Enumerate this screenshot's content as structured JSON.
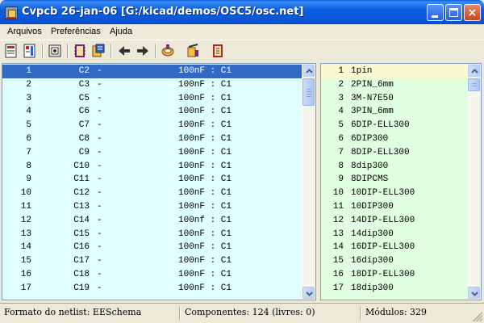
{
  "window": {
    "title": "Cvpcb 26-jan-06 [G:/kicad/demos/OSC5/osc.net]",
    "minimize": "_",
    "maximize": "□",
    "close": "×"
  },
  "menu": {
    "items": [
      "Arquivos",
      "Preferências",
      "Ajuda"
    ]
  },
  "toolbar": {
    "icons": [
      "open-netlist-icon",
      "save-netlist-icon",
      "config-icon",
      "footprint-display-icon",
      "documentation-icon",
      "previous-arrow-icon",
      "next-arrow-icon",
      "auto-associate-icon",
      "delete-association-icon",
      "print-list-icon"
    ]
  },
  "components": {
    "rows": [
      {
        "num": "1",
        "ref": "C2",
        "dash": "-",
        "value": "100nF : C1"
      },
      {
        "num": "2",
        "ref": "C3",
        "dash": "-",
        "value": "100nF : C1"
      },
      {
        "num": "3",
        "ref": "C5",
        "dash": "-",
        "value": "100nF : C1"
      },
      {
        "num": "4",
        "ref": "C6",
        "dash": "-",
        "value": "100nF : C1"
      },
      {
        "num": "5",
        "ref": "C7",
        "dash": "-",
        "value": "100nF : C1"
      },
      {
        "num": "6",
        "ref": "C8",
        "dash": "-",
        "value": "100nF : C1"
      },
      {
        "num": "7",
        "ref": "C9",
        "dash": "-",
        "value": "100nF : C1"
      },
      {
        "num": "8",
        "ref": "C10",
        "dash": "-",
        "value": "100nF : C1"
      },
      {
        "num": "9",
        "ref": "C11",
        "dash": "-",
        "value": "100nF : C1"
      },
      {
        "num": "10",
        "ref": "C12",
        "dash": "-",
        "value": "100nF : C1"
      },
      {
        "num": "11",
        "ref": "C13",
        "dash": "-",
        "value": "100nF : C1"
      },
      {
        "num": "12",
        "ref": "C14",
        "dash": "-",
        "value": "100nf : C1"
      },
      {
        "num": "13",
        "ref": "C15",
        "dash": "-",
        "value": "100nF : C1"
      },
      {
        "num": "14",
        "ref": "C16",
        "dash": "-",
        "value": "100nF : C1"
      },
      {
        "num": "15",
        "ref": "C17",
        "dash": "-",
        "value": "100nF : C1"
      },
      {
        "num": "16",
        "ref": "C18",
        "dash": "-",
        "value": "100nF : C1"
      },
      {
        "num": "17",
        "ref": "C19",
        "dash": "-",
        "value": "100nF : C1"
      }
    ]
  },
  "footprints": {
    "rows": [
      {
        "num": "1",
        "name": "1pin"
      },
      {
        "num": "2",
        "name": "2PIN_6mm"
      },
      {
        "num": "3",
        "name": "3M-N7E50"
      },
      {
        "num": "4",
        "name": "3PIN_6mm"
      },
      {
        "num": "5",
        "name": "6DIP-ELL300"
      },
      {
        "num": "6",
        "name": "6DIP300"
      },
      {
        "num": "7",
        "name": "8DIP-ELL300"
      },
      {
        "num": "8",
        "name": "8dip300"
      },
      {
        "num": "9",
        "name": "8DIPCMS"
      },
      {
        "num": "10",
        "name": "10DIP-ELL300"
      },
      {
        "num": "11",
        "name": "10DIP300"
      },
      {
        "num": "12",
        "name": "14DIP-ELL300"
      },
      {
        "num": "13",
        "name": "14dip300"
      },
      {
        "num": "14",
        "name": "16DIP-ELL300"
      },
      {
        "num": "15",
        "name": "16dip300"
      },
      {
        "num": "16",
        "name": "18DIP-ELL300"
      },
      {
        "num": "17",
        "name": "18dip300"
      }
    ]
  },
  "status": {
    "netlist_format": "Formato do netlist: EESchema",
    "components": "Componentes: 124 (livres: 0)",
    "modules": "Módulos: 329"
  },
  "colors": {
    "selection": "#316ac5",
    "components_bg": "#e0ffff",
    "footprints_bg": "#e0ffe0",
    "title_bar": "#0a55d6"
  }
}
